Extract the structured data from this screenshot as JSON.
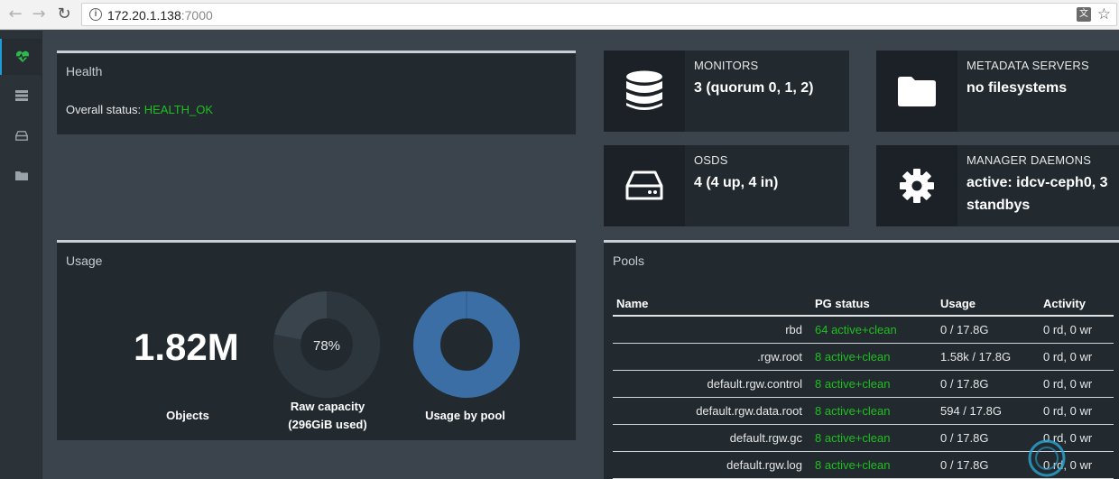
{
  "browser": {
    "url_host": "172.20.1.138",
    "url_port": ":7000"
  },
  "sidebar": {
    "items": [
      "health-icon",
      "list-icon",
      "drive-icon",
      "folder-icon"
    ]
  },
  "health": {
    "title": "Health",
    "status_label": "Overall status:",
    "status_value": "HEALTH_OK"
  },
  "tiles": {
    "monitors": {
      "label": "MONITORS",
      "value": "3 (quorum 0, 1, 2)",
      "icon": "database-icon"
    },
    "mds": {
      "label": "METADATA SERVERS",
      "value": "no filesystems",
      "icon": "folder-icon"
    },
    "osds": {
      "label": "OSDS",
      "value": "4 (4 up, 4 in)",
      "icon": "drive-icon"
    },
    "mgr": {
      "label": "MANAGER DAEMONS",
      "value": "active: idcv-ceph0, 3 standbys",
      "icon": "gear-icon"
    }
  },
  "usage": {
    "title": "Usage",
    "objects_value": "1.82M",
    "objects_label": "Objects",
    "raw_percent_label": "78%",
    "raw_percent": 78,
    "raw_label_line1": "Raw capacity",
    "raw_label_line2": "(296GiB used)",
    "pool_label": "Usage by pool"
  },
  "pools": {
    "title": "Pools",
    "columns": [
      "Name",
      "PG status",
      "Usage",
      "Activity"
    ],
    "rows": [
      [
        "rbd",
        "64 active+clean",
        "0 / 17.8G",
        "0 rd, 0 wr"
      ],
      [
        ".rgw.root",
        "8 active+clean",
        "1.58k / 17.8G",
        "0 rd, 0 wr"
      ],
      [
        "default.rgw.control",
        "8 active+clean",
        "0 / 17.8G",
        "0 rd, 0 wr"
      ],
      [
        "default.rgw.data.root",
        "8 active+clean",
        "594 / 17.8G",
        "0 rd, 0 wr"
      ],
      [
        "default.rgw.gc",
        "8 active+clean",
        "0 / 17.8G",
        "0 rd, 0 wr"
      ],
      [
        "default.rgw.log",
        "8 active+clean",
        "0 / 17.8G",
        "0 rd, 0 wr"
      ]
    ]
  },
  "colors": {
    "ok_green": "#1fbf1f",
    "donut_fill": "#3a444d",
    "pool_blue": "#3a6ea5",
    "active_accent": "#1f9bd6"
  }
}
